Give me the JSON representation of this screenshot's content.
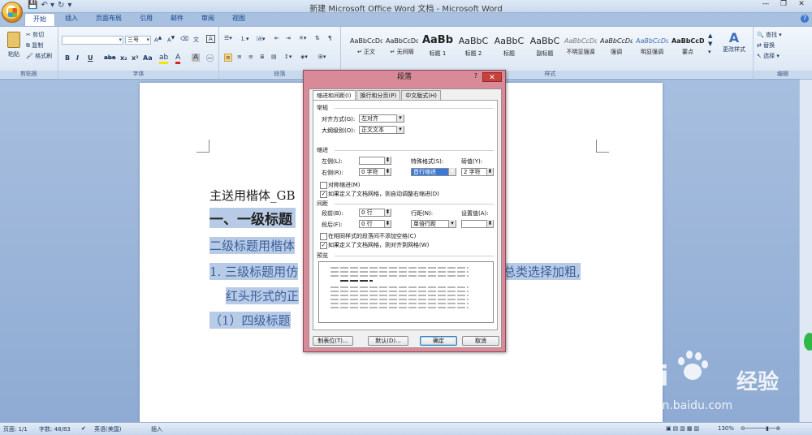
{
  "window": {
    "title": "新建 Microsoft Office Word 文档 - Microsoft Word",
    "qat": [
      "💾",
      "↶ ▾",
      "↻",
      "▾"
    ]
  },
  "tabs": [
    "开始",
    "插入",
    "页面布局",
    "引用",
    "邮件",
    "审阅",
    "视图"
  ],
  "ribbon": {
    "clipboard": {
      "label": "剪贴板",
      "paste": "粘贴",
      "cut": "剪切",
      "copy": "复制",
      "format_painter": "格式刷"
    },
    "font": {
      "label": "字体",
      "font_name": "",
      "font_size": "三号",
      "buttons": [
        "B",
        "I",
        "U",
        "abe",
        "x₂",
        "x²",
        "Aa"
      ]
    },
    "paragraph": {
      "label": "段落"
    },
    "styles": {
      "label": "样式",
      "items": [
        {
          "sample": "AaBbCcDd",
          "name": "↵ 正文",
          "kind": ""
        },
        {
          "sample": "AaBbCcDd",
          "name": "↵ 无间隔",
          "kind": ""
        },
        {
          "sample": "AaBb",
          "name": "标题 1",
          "kind": "big"
        },
        {
          "sample": "AaBbC",
          "name": "标题 2",
          "kind": "med"
        },
        {
          "sample": "AaBbC",
          "name": "标题",
          "kind": "med"
        },
        {
          "sample": "AaBbC",
          "name": "副标题",
          "kind": "med"
        },
        {
          "sample": "AaBbCcDd",
          "name": "不明显强调",
          "kind": ""
        },
        {
          "sample": "AaBbCcDd",
          "name": "强调",
          "kind": ""
        },
        {
          "sample": "AaBbCcDd",
          "name": "明显强调",
          "kind": ""
        },
        {
          "sample": "AaBbCcDd",
          "name": "要点",
          "kind": ""
        }
      ],
      "change_styles": "更改样式"
    },
    "editing": {
      "label": "编辑",
      "find": "查找 ▾",
      "replace": "替换",
      "select": "选择 ▾"
    }
  },
  "document": {
    "line1": "主送用楷体_GB",
    "line2": "一、一级标题",
    "line3": "二级标题用楷体",
    "line4a": "1. 三级标题用仿",
    "line4b": "总类选择加粗,",
    "line5": "红头形式的正",
    "line6": "（1）四级标题"
  },
  "dialog": {
    "title": "段落",
    "help": "?",
    "close": "✕",
    "tabs": [
      "缩进和间距(I)",
      "换行和分页(P)",
      "中文版式(H)"
    ],
    "general": {
      "section": "常规",
      "alignment_label": "对齐方式(G):",
      "alignment_value": "左对齐",
      "outline_label": "大纲级别(O):",
      "outline_value": "正文文本"
    },
    "indent": {
      "section": "缩进",
      "left_label": "左侧(L):",
      "left_value": "",
      "right_label": "右侧(R):",
      "right_value": "0 字符",
      "special_label": "特殊格式(S):",
      "special_value": "首行缩进",
      "by_label": "磅值(Y):",
      "by_value": "2 字符",
      "mirror": "对称缩进(M)",
      "auto_adjust": "如果定义了文档网格，则自动调整右缩进(D)"
    },
    "spacing": {
      "section": "间距",
      "before_label": "段前(B):",
      "before_value": "0 行",
      "after_label": "段后(F):",
      "after_value": "0 行",
      "line_label": "行距(N):",
      "line_value": "单倍行距",
      "at_label": "设置值(A):",
      "at_value": "",
      "no_space": "在相同样式的段落间不添加空格(C)",
      "snap_grid": "如果定义了文档网格，则对齐到网格(W)"
    },
    "preview_label": "预览",
    "buttons": {
      "tabs": "制表位(T)...",
      "default": "默认(D)...",
      "ok": "确定",
      "cancel": "取消"
    }
  },
  "statusbar": {
    "page": "页面: 1/1",
    "words": "字数: 48/83",
    "language": "英语(美国)",
    "mode": "插入",
    "zoom": "130%"
  },
  "watermark": {
    "brand": "Bai",
    "brand2": "经验",
    "url": "jingyan.baidu.com"
  }
}
